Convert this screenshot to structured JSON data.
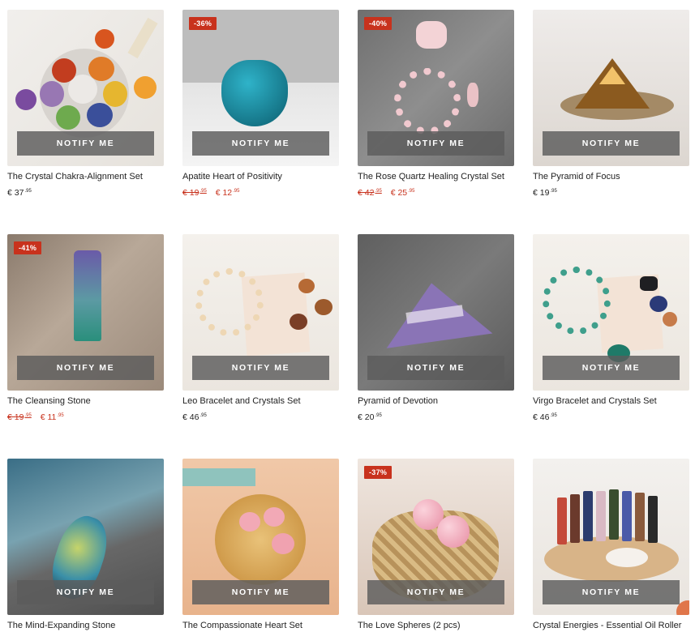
{
  "colors": {
    "sale": "#c8321d",
    "overlay": "#5c5c5c"
  },
  "notify_label": "NOTIFY ME",
  "products": [
    {
      "name": "The Crystal Chakra-Alignment Set",
      "price": "€ 37",
      "price_cents": ".95",
      "old_price": "",
      "old_cents": "",
      "badge": ""
    },
    {
      "name": "Apatite Heart of Positivity",
      "price": "€ 12",
      "price_cents": ".95",
      "old_price": "€ 19",
      "old_cents": ".95",
      "badge": "-36%"
    },
    {
      "name": "The Rose Quartz Healing Crystal Set",
      "price": "€ 25",
      "price_cents": ".95",
      "old_price": "€ 42",
      "old_cents": ".95",
      "badge": "-40%"
    },
    {
      "name": "The Pyramid of Focus",
      "price": "€ 19",
      "price_cents": ".95",
      "old_price": "",
      "old_cents": "",
      "badge": ""
    },
    {
      "name": "The Cleansing Stone",
      "price": "€ 11",
      "price_cents": ".95",
      "old_price": "€ 19",
      "old_cents": ".95",
      "badge": "-41%"
    },
    {
      "name": "Leo Bracelet and Crystals Set",
      "price": "€ 46",
      "price_cents": ".95",
      "old_price": "",
      "old_cents": "",
      "badge": ""
    },
    {
      "name": "Pyramid of Devotion",
      "price": "€ 20",
      "price_cents": ".95",
      "old_price": "",
      "old_cents": "",
      "badge": ""
    },
    {
      "name": "Virgo Bracelet and Crystals Set",
      "price": "€ 46",
      "price_cents": ".95",
      "old_price": "",
      "old_cents": "",
      "badge": ""
    },
    {
      "name": "The Mind-Expanding Stone",
      "price": "",
      "price_cents": "",
      "old_price": "",
      "old_cents": "",
      "badge": ""
    },
    {
      "name": "The Compassionate Heart Set",
      "price": "",
      "price_cents": "",
      "old_price": "",
      "old_cents": "",
      "badge": ""
    },
    {
      "name": "The Love Spheres (2 pcs)",
      "price": "",
      "price_cents": "",
      "old_price": "",
      "old_cents": "",
      "badge": "-37%"
    },
    {
      "name": "Crystal Energies - Essential Oil Roller",
      "price": "",
      "price_cents": "",
      "old_price": "",
      "old_cents": "",
      "badge": ""
    }
  ]
}
